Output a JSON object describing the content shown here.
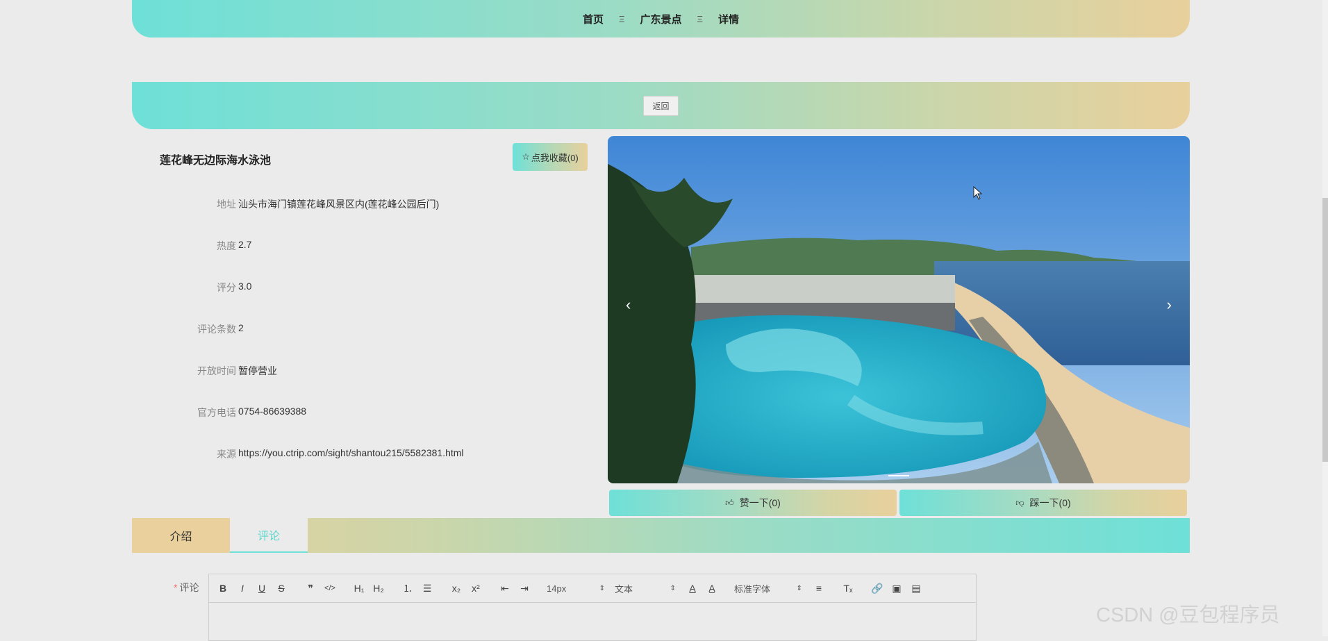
{
  "breadcrumb": {
    "items": [
      "首页",
      "广东景点",
      "详情"
    ],
    "separator": "Ξ"
  },
  "back_button": "返回",
  "spot": {
    "title": "莲花峰无边际海水泳池",
    "favorite_button": "点我收藏(0)",
    "info": [
      {
        "label": "地址",
        "value": "汕头市海门镇莲花峰风景区内(莲花峰公园后门)"
      },
      {
        "label": "热度",
        "value": "2.7"
      },
      {
        "label": "评分",
        "value": "3.0"
      },
      {
        "label": "评论条数",
        "value": "2"
      },
      {
        "label": "开放时间",
        "value": "暂停营业"
      },
      {
        "label": "官方电话",
        "value": "0754-86639388"
      },
      {
        "label": "来源",
        "value": "https://you.ctrip.com/sight/shantou215/5582381.html"
      }
    ]
  },
  "carousel": {
    "prev": "‹",
    "next": "›"
  },
  "vote": {
    "like": "赞一下(0)",
    "dislike": "踩一下(0)"
  },
  "tabs": {
    "intro": "介绍",
    "comment": "评论",
    "active": "comment"
  },
  "comment": {
    "required_mark": "*",
    "label": "评论",
    "toolbar": {
      "bold": "B",
      "italic": "I",
      "underline": "U",
      "strike": "S",
      "quote": "❞",
      "code": "</>",
      "h1": "H₁",
      "h2": "H₂",
      "ordered_list": "⒈",
      "bullet_list": "☰",
      "subscript": "x₂",
      "superscript": "x²",
      "outdent": "⇤",
      "indent": "⇥",
      "size": "14px",
      "header": "文本",
      "font": "标准字体",
      "align": "≡",
      "clean": "Tₓ",
      "link": "🔗",
      "image": "▣",
      "video": "▤",
      "color": "A",
      "background": "A̲"
    }
  },
  "watermark": "CSDN @豆包程序员",
  "colors": {
    "accent_teal": "#6ee0d8",
    "accent_tan": "#e9d09c",
    "active_tab_text": "#5fd6cc"
  }
}
